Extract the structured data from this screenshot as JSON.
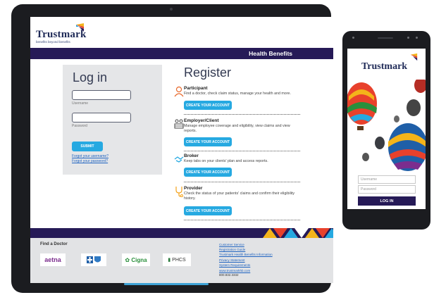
{
  "brand": {
    "name": "Trustmark",
    "tagline": "benefits beyond benefits",
    "colors": {
      "navy": "#261a57",
      "accent": "#26a9e1",
      "link": "#1d62c0",
      "panel": "#e5e6e8"
    }
  },
  "header": {
    "section_title": "Health Benefits"
  },
  "login": {
    "title": "Log in",
    "username_label": "Username",
    "password_label": "Password",
    "submit_label": "SUBMIT",
    "forgot_username": "Forgot your username?",
    "forgot_password": "Forgot your password?"
  },
  "register": {
    "title": "Register",
    "items": [
      {
        "icon": "participant-icon",
        "name": "Participant",
        "desc": "Find a doctor, check claim status, manage your health and more.",
        "button": "CREATE YOUR ACCOUNT"
      },
      {
        "icon": "employer-icon",
        "name": "Employer/Client",
        "desc": "Manage employee coverage and eligibility, view claims and view reports.",
        "button": "CREATE YOUR ACCOUNT"
      },
      {
        "icon": "broker-icon",
        "name": "Broker",
        "desc": "Keep tabs on your clients' plan and access reports.",
        "button": "CREATE YOUR ACCOUNT"
      },
      {
        "icon": "provider-icon",
        "name": "Provider",
        "desc": "Check the status of your patients' claims and confirm their eligibility history.",
        "button": "CREATE YOUR ACCOUNT"
      }
    ]
  },
  "footer": {
    "find_doctor": "Find a Doctor",
    "networks": [
      "aetna",
      "BlueCross BlueShield",
      "Cigna",
      "PHCS"
    ],
    "links": [
      "Customer Service",
      "Registration Guide",
      "Trustmark Health Benefits Information",
      "Privacy Statement",
      "System Requirements",
      "www.trustmarkhb.com"
    ],
    "phone": "800.832.3332"
  },
  "phone": {
    "logo": "Trustmark",
    "username_placeholder": "Username",
    "password_placeholder": "Password",
    "login_label": "LOG IN"
  }
}
